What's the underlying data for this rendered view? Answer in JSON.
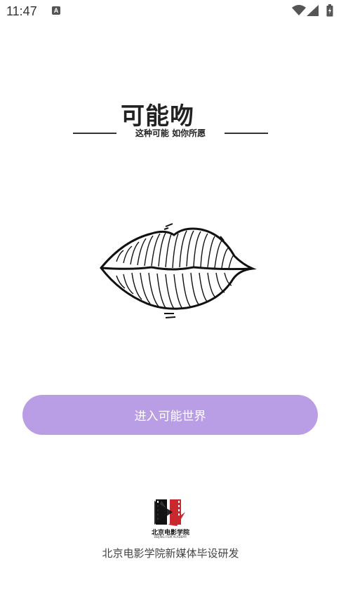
{
  "status_bar": {
    "time": "11:47",
    "notification_icon": "a-icon"
  },
  "logo": {
    "title": "可能吻",
    "slogan": "这种可能  如你所愿"
  },
  "illustration": {
    "icon": "lips-icon"
  },
  "enter_button": {
    "label": "进入可能世界",
    "color": "#b99ee6"
  },
  "footer": {
    "logo_text": "北京电影学院",
    "logo_subtext": "BEIJING FILM ACADEMY",
    "credit": "北京电影学院新媒体毕设研发"
  }
}
